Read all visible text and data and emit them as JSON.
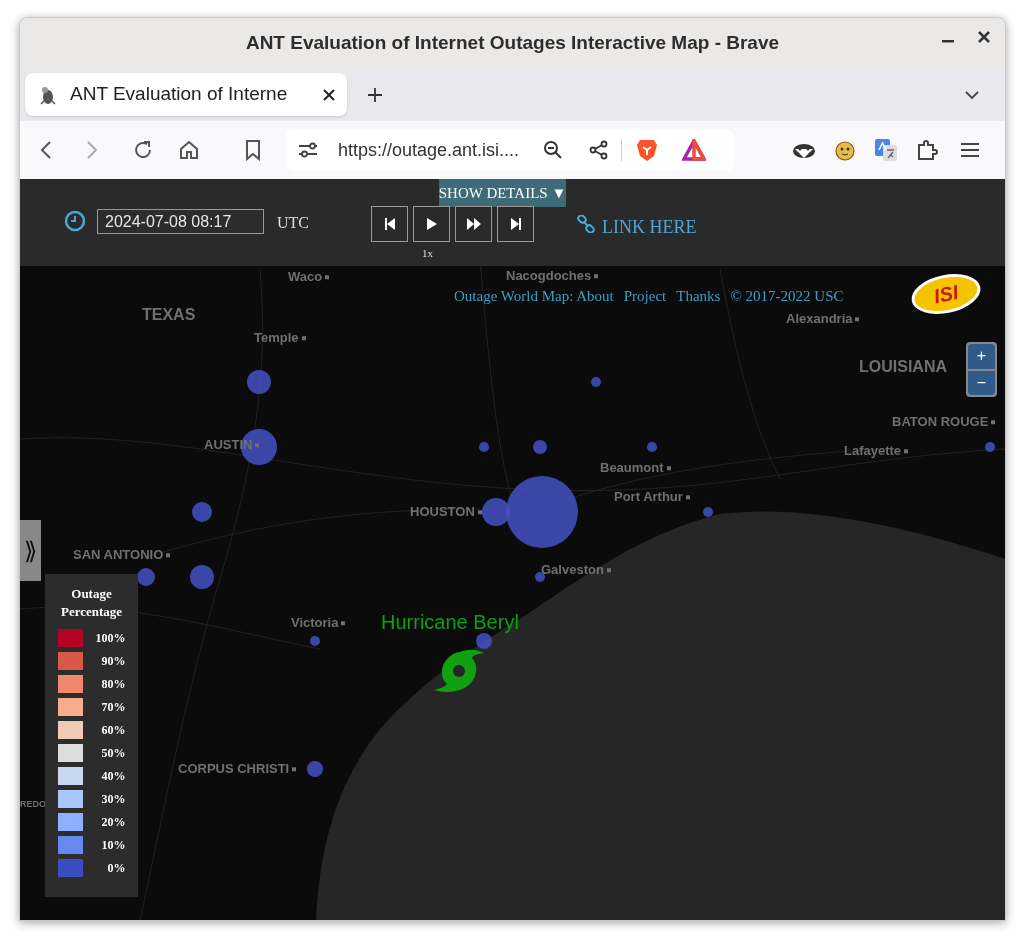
{
  "window": {
    "title": "ANT Evaluation of Internet Outages Interactive Map - Brave"
  },
  "tabs": [
    {
      "title": "ANT Evaluation of Interne",
      "selected": true
    }
  ],
  "address_bar": {
    "url": "https://outage.ant.isi...."
  },
  "controls": {
    "show_details": "SHOW DETAILS ▼",
    "date": "2024-07-08 08:17",
    "timezone": "UTC",
    "speed": "1x",
    "link": "LINK HERE"
  },
  "footer_links": [
    "Outage World Map: About",
    "Project",
    "Thanks",
    "© 2017-2022 USC"
  ],
  "logo": "ISI",
  "zoom": [
    "+",
    "−"
  ],
  "sidebar_toggle": "⟫",
  "map": {
    "places": [
      {
        "name": "TEXAS",
        "kind": "state"
      },
      {
        "name": "Waco",
        "kind": "city"
      },
      {
        "name": "Nacogdoches",
        "kind": "city"
      },
      {
        "name": "Alexandria",
        "kind": "city"
      },
      {
        "name": "Temple",
        "kind": "city"
      },
      {
        "name": "LOUISIANA",
        "kind": "state"
      },
      {
        "name": "BATON ROUGE",
        "kind": "city"
      },
      {
        "name": "AUSTIN",
        "kind": "city"
      },
      {
        "name": "Lafayette",
        "kind": "city"
      },
      {
        "name": "Beaumont",
        "kind": "city"
      },
      {
        "name": "Port Arthur",
        "kind": "city"
      },
      {
        "name": "HOUSTON",
        "kind": "city"
      },
      {
        "name": "SAN ANTONIO",
        "kind": "city"
      },
      {
        "name": "Galveston",
        "kind": "city"
      },
      {
        "name": "Victoria",
        "kind": "city"
      },
      {
        "name": "CORPUS CHRISTI",
        "kind": "city"
      },
      {
        "name": "REDO",
        "kind": "city"
      }
    ],
    "storm_label": "Hurricane Beryl"
  },
  "legend": {
    "title": "Outage Percentage",
    "items": [
      {
        "label": "100%",
        "color": "#b40426"
      },
      {
        "label": "90%",
        "color": "#d95847"
      },
      {
        "label": "80%",
        "color": "#ef886b"
      },
      {
        "label": "70%",
        "color": "#f7ac8e"
      },
      {
        "label": "60%",
        "color": "#f2cbb7"
      },
      {
        "label": "50%",
        "color": "#dddddd"
      },
      {
        "label": "40%",
        "color": "#c9d7f0"
      },
      {
        "label": "30%",
        "color": "#aac7fd"
      },
      {
        "label": "20%",
        "color": "#8db0fe"
      },
      {
        "label": "10%",
        "color": "#6788ee"
      },
      {
        "label": "0%",
        "color": "#3b4cc0"
      }
    ]
  }
}
